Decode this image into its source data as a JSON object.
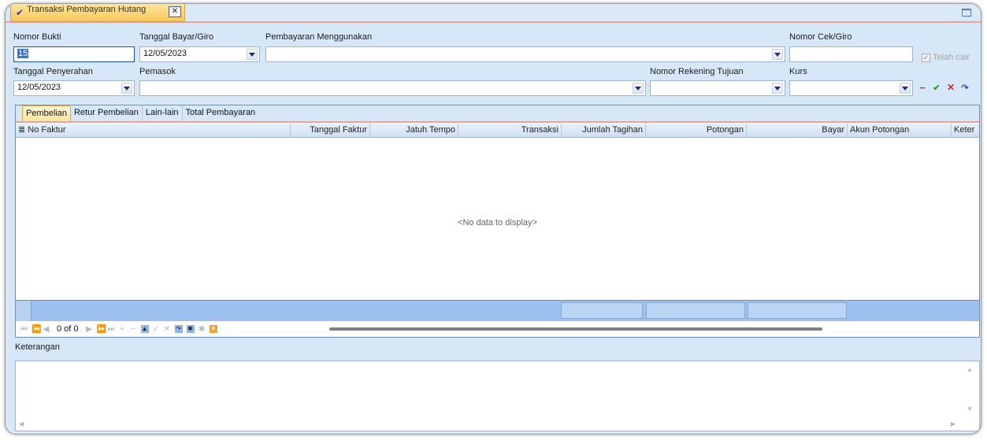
{
  "doc_tab": {
    "title": "Transaksi Pembayaran Hutang",
    "pencil_icon": "✔",
    "close_icon": "✕"
  },
  "form": {
    "nomor_bukti": {
      "label": "Nomor Bukti",
      "value": "15"
    },
    "tanggal_bayar": {
      "label": "Tanggal Bayar/Giro",
      "value": "12/05/2023"
    },
    "pembayaran": {
      "label": "Pembayaran Menggunakan",
      "value": ""
    },
    "nomor_cek": {
      "label": "Nomor Cek/Giro",
      "value": ""
    },
    "telah_cair": {
      "label": "Telah cair",
      "checked": true
    },
    "tanggal_penyerahan": {
      "label": "Tanggal Penyerahan",
      "value": "12/05/2023"
    },
    "pemasok": {
      "label": "Pemasok",
      "value": ""
    },
    "nomor_rekening": {
      "label": "Nomor Rekening Tujuan",
      "value": ""
    },
    "kurs": {
      "label": "Kurs",
      "value": ""
    }
  },
  "row_buttons": {
    "minus": "−",
    "check": "✔",
    "cancel": "✕",
    "refresh": "↷"
  },
  "tabs": [
    "Pembelian",
    "Retur Pembelian",
    "Lain-lain",
    "Total Pembayaran"
  ],
  "grid": {
    "columns": [
      "No Faktur",
      "Tanggal Faktur",
      "Jatuh Tempo",
      "Transaksi",
      "Jumlah Tagihan",
      "Potongan",
      "Bayar",
      "Akun Potongan",
      "Keter"
    ],
    "empty_text": "<No data to display>",
    "record_count": "0 of 0"
  },
  "navigator_icons": [
    "⏮",
    "⏪",
    "◀",
    "▶",
    "⏩",
    "⏭",
    "+",
    "−",
    "▲",
    "✓",
    "✕",
    "↷",
    "✱",
    "✱",
    "▼"
  ],
  "memo": {
    "label": "Keterangan",
    "value": ""
  },
  "colors": {
    "accent": "#3374d6",
    "tab_active": "#fde49a",
    "footer": "#9dc1ef"
  }
}
